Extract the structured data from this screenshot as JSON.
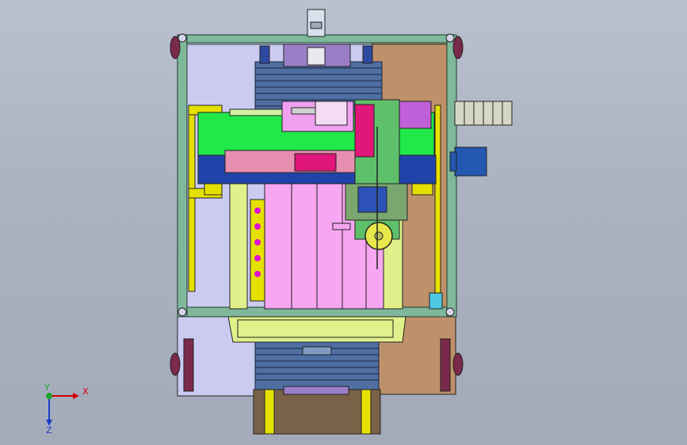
{
  "viewport": {
    "background_top": "#b9c1cf",
    "background_bottom": "#a3abbb"
  },
  "model": {
    "description_icon": "cad-assembly-top-view",
    "colors": {
      "frame_panel_left": "#cbcbf2",
      "frame_panel_right": "#bf916a",
      "frame_rail": "#4c8f6c",
      "green_plate": "#22e84a",
      "blue_beam": "#1f43a8",
      "pink_carriage": "#f7a6f1",
      "magenta_block": "#e0167a",
      "yellow_rail": "#e6e000",
      "bellows": "#4f6fa3",
      "brown_box": "#7a6248",
      "drag_chain": "#d6d6c6",
      "tray": "#e0f08a"
    }
  },
  "triad": {
    "x_label": "X",
    "y_label": "Y",
    "z_label": "Z"
  }
}
